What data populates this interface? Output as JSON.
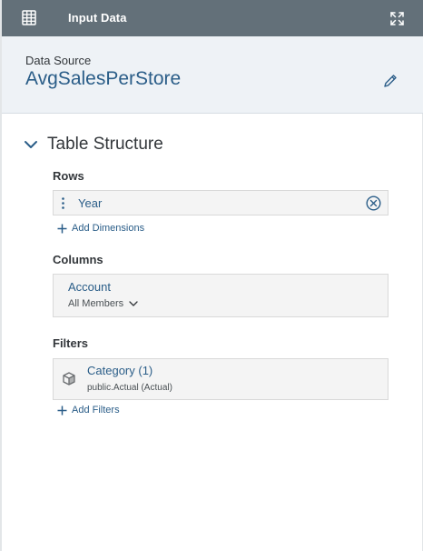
{
  "header": {
    "title": "Input Data",
    "table_icon": "table-icon",
    "expand_icon": "expand-icon"
  },
  "data_source": {
    "label": "Data Source",
    "name": "AvgSalesPerStore",
    "edit_icon": "pencil-icon"
  },
  "table_structure": {
    "title": "Table Structure",
    "rows": {
      "label": "Rows",
      "items": [
        {
          "name": "Year"
        }
      ],
      "add_label": "Add Dimensions"
    },
    "columns": {
      "label": "Columns",
      "items": [
        {
          "name": "Account",
          "members": "All Members"
        }
      ]
    },
    "filters": {
      "label": "Filters",
      "items": [
        {
          "name": "Category (1)",
          "detail": "public.Actual (Actual)"
        }
      ],
      "add_label": "Add Filters"
    }
  },
  "colors": {
    "header_bg": "#637079",
    "accent": "#2a5d88",
    "source_bg": "#eef2f6"
  }
}
